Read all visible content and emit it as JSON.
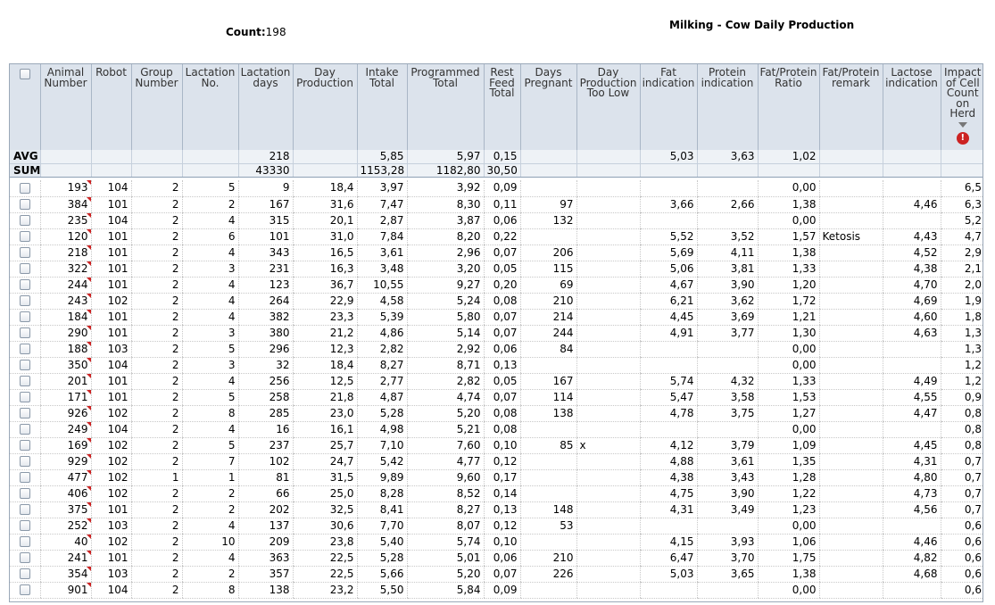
{
  "header": {
    "count_label": "Count:",
    "count_value": "198",
    "title": "Milking - Cow Daily Production"
  },
  "columns": [
    "Animal Number",
    "Robot",
    "Group Number",
    "Lactation No.",
    "Lactation days",
    "Day Production",
    "Intake Total",
    "Programmed Total",
    "Rest Feed Total",
    "Days Pregnant",
    "Day Production Too Low",
    "Fat indication",
    "Protein indication",
    "Fat/Protein Ratio",
    "Fat/Protein remark",
    "Lactose indication",
    "Impact of Cell Count on Herd"
  ],
  "icons": {
    "sort": "sort-desc-icon",
    "alert": "alert-icon",
    "alert_glyph": "!"
  },
  "summary": [
    {
      "label": "AVG",
      "cells": [
        "",
        "",
        "",
        "",
        "218",
        "",
        "5,85",
        "5,97",
        "0,15",
        "",
        "",
        "5,03",
        "3,63",
        "1,02",
        "",
        "",
        ""
      ]
    },
    {
      "label": "SUM",
      "cells": [
        "",
        "",
        "",
        "",
        "43330",
        "",
        "1153,28",
        "1182,80",
        "30,50",
        "",
        "",
        "",
        "",
        "",
        "",
        "",
        ""
      ]
    }
  ],
  "rows": [
    [
      "193",
      "104",
      "2",
      "5",
      "9",
      "18,4",
      "3,97",
      "3,92",
      "0,09",
      "",
      "",
      "",
      "",
      "0,00",
      "",
      "",
      "6,5"
    ],
    [
      "384",
      "101",
      "2",
      "2",
      "167",
      "31,6",
      "7,47",
      "8,30",
      "0,11",
      "97",
      "",
      "3,66",
      "2,66",
      "1,38",
      "",
      "4,46",
      "6,3"
    ],
    [
      "235",
      "104",
      "2",
      "4",
      "315",
      "20,1",
      "2,87",
      "3,87",
      "0,06",
      "132",
      "",
      "",
      "",
      "0,00",
      "",
      "",
      "5,2"
    ],
    [
      "120",
      "101",
      "2",
      "6",
      "101",
      "31,0",
      "7,84",
      "8,20",
      "0,22",
      "",
      "",
      "5,52",
      "3,52",
      "1,57",
      "Ketosis",
      "4,43",
      "4,7"
    ],
    [
      "218",
      "101",
      "2",
      "4",
      "343",
      "16,5",
      "3,61",
      "2,96",
      "0,07",
      "206",
      "",
      "5,69",
      "4,11",
      "1,38",
      "",
      "4,52",
      "2,9"
    ],
    [
      "322",
      "101",
      "2",
      "3",
      "231",
      "16,3",
      "3,48",
      "3,20",
      "0,05",
      "115",
      "",
      "5,06",
      "3,81",
      "1,33",
      "",
      "4,38",
      "2,1"
    ],
    [
      "244",
      "101",
      "2",
      "4",
      "123",
      "36,7",
      "10,55",
      "9,27",
      "0,20",
      "69",
      "",
      "4,67",
      "3,90",
      "1,20",
      "",
      "4,70",
      "2,0"
    ],
    [
      "243",
      "102",
      "2",
      "4",
      "264",
      "22,9",
      "4,58",
      "5,24",
      "0,08",
      "210",
      "",
      "6,21",
      "3,62",
      "1,72",
      "",
      "4,69",
      "1,9"
    ],
    [
      "184",
      "101",
      "2",
      "4",
      "382",
      "23,3",
      "5,39",
      "5,80",
      "0,07",
      "214",
      "",
      "4,45",
      "3,69",
      "1,21",
      "",
      "4,60",
      "1,8"
    ],
    [
      "290",
      "101",
      "2",
      "3",
      "380",
      "21,2",
      "4,86",
      "5,14",
      "0,07",
      "244",
      "",
      "4,91",
      "3,77",
      "1,30",
      "",
      "4,63",
      "1,3"
    ],
    [
      "188",
      "103",
      "2",
      "5",
      "296",
      "12,3",
      "2,82",
      "2,92",
      "0,06",
      "84",
      "",
      "",
      "",
      "0,00",
      "",
      "",
      "1,3"
    ],
    [
      "350",
      "104",
      "2",
      "3",
      "32",
      "18,4",
      "8,27",
      "8,71",
      "0,13",
      "",
      "",
      "",
      "",
      "0,00",
      "",
      "",
      "1,2"
    ],
    [
      "201",
      "101",
      "2",
      "4",
      "256",
      "12,5",
      "2,77",
      "2,82",
      "0,05",
      "167",
      "",
      "5,74",
      "4,32",
      "1,33",
      "",
      "4,49",
      "1,2"
    ],
    [
      "171",
      "101",
      "2",
      "5",
      "258",
      "21,8",
      "4,87",
      "4,74",
      "0,07",
      "114",
      "",
      "5,47",
      "3,58",
      "1,53",
      "",
      "4,55",
      "0,9"
    ],
    [
      "926",
      "102",
      "2",
      "8",
      "285",
      "23,0",
      "5,28",
      "5,20",
      "0,08",
      "138",
      "",
      "4,78",
      "3,75",
      "1,27",
      "",
      "4,47",
      "0,8"
    ],
    [
      "249",
      "104",
      "2",
      "4",
      "16",
      "16,1",
      "4,98",
      "5,21",
      "0,08",
      "",
      "",
      "",
      "",
      "0,00",
      "",
      "",
      "0,8"
    ],
    [
      "169",
      "102",
      "2",
      "5",
      "237",
      "25,7",
      "7,10",
      "7,60",
      "0,10",
      "85",
      "x",
      "4,12",
      "3,79",
      "1,09",
      "",
      "4,45",
      "0,8"
    ],
    [
      "929",
      "102",
      "2",
      "7",
      "102",
      "24,7",
      "5,42",
      "4,77",
      "0,12",
      "",
      "",
      "4,88",
      "3,61",
      "1,35",
      "",
      "4,31",
      "0,7"
    ],
    [
      "477",
      "102",
      "1",
      "1",
      "81",
      "31,5",
      "9,89",
      "9,60",
      "0,17",
      "",
      "",
      "4,38",
      "3,43",
      "1,28",
      "",
      "4,80",
      "0,7"
    ],
    [
      "406",
      "102",
      "2",
      "2",
      "66",
      "25,0",
      "8,28",
      "8,52",
      "0,14",
      "",
      "",
      "4,75",
      "3,90",
      "1,22",
      "",
      "4,73",
      "0,7"
    ],
    [
      "375",
      "101",
      "2",
      "2",
      "202",
      "32,5",
      "8,41",
      "8,27",
      "0,13",
      "148",
      "",
      "4,31",
      "3,49",
      "1,23",
      "",
      "4,56",
      "0,7"
    ],
    [
      "252",
      "103",
      "2",
      "4",
      "137",
      "30,6",
      "7,70",
      "8,07",
      "0,12",
      "53",
      "",
      "",
      "",
      "0,00",
      "",
      "",
      "0,6"
    ],
    [
      "40",
      "102",
      "2",
      "10",
      "209",
      "23,8",
      "5,40",
      "5,74",
      "0,10",
      "",
      "",
      "4,15",
      "3,93",
      "1,06",
      "",
      "4,46",
      "0,6"
    ],
    [
      "241",
      "101",
      "2",
      "4",
      "363",
      "22,5",
      "5,28",
      "5,01",
      "0,06",
      "210",
      "",
      "6,47",
      "3,70",
      "1,75",
      "",
      "4,82",
      "0,6"
    ],
    [
      "354",
      "103",
      "2",
      "2",
      "357",
      "22,5",
      "5,66",
      "5,20",
      "0,07",
      "226",
      "",
      "5,03",
      "3,65",
      "1,38",
      "",
      "4,68",
      "0,6"
    ],
    [
      "901",
      "104",
      "2",
      "8",
      "138",
      "23,2",
      "5,50",
      "5,84",
      "0,09",
      "",
      "",
      "",
      "",
      "0,00",
      "",
      "",
      "0,6"
    ]
  ]
}
